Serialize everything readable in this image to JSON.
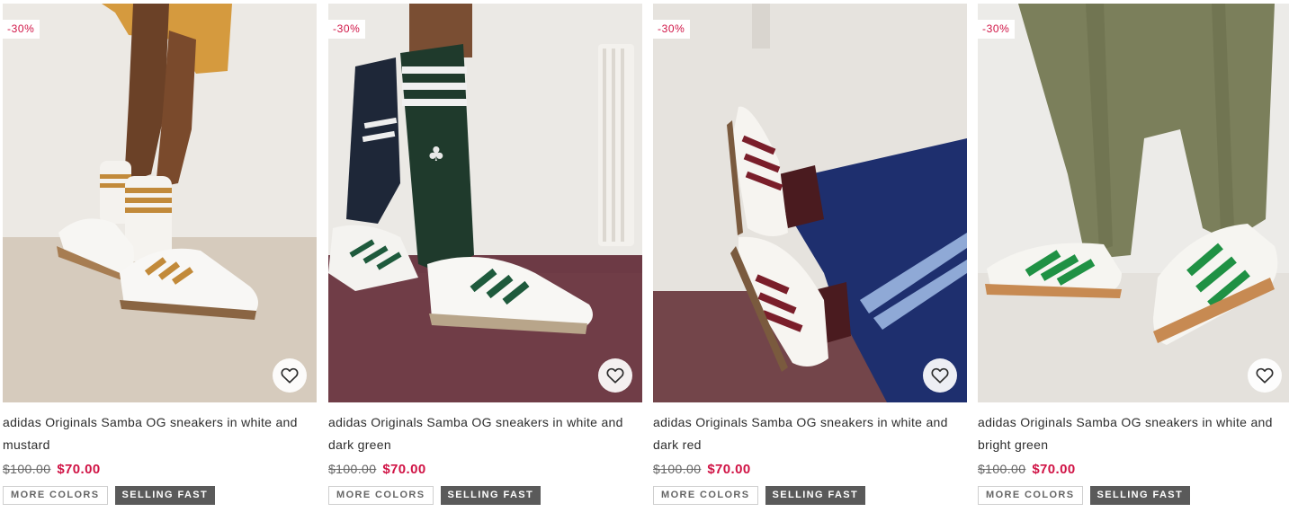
{
  "products": [
    {
      "badge": "-30%",
      "title": "adidas Originals Samba OG sneakers in white and mustard",
      "price_old": "$100.00",
      "price_new": "$70.00",
      "tag_more": "MORE COLORS",
      "tag_fast": "SELLING FAST",
      "image": "white-mustard-sneakers-photo"
    },
    {
      "badge": "-30%",
      "title": "adidas Originals Samba OG sneakers in white and dark green",
      "price_old": "$100.00",
      "price_new": "$70.00",
      "tag_more": "MORE COLORS",
      "tag_fast": "SELLING FAST",
      "image": "white-dark-green-sneakers-photo"
    },
    {
      "badge": "-30%",
      "title": "adidas Originals Samba OG sneakers in white and dark red",
      "price_old": "$100.00",
      "price_new": "$70.00",
      "tag_more": "MORE COLORS",
      "tag_fast": "SELLING FAST",
      "image": "white-dark-red-sneakers-photo"
    },
    {
      "badge": "-30%",
      "title": "adidas Originals Samba OG sneakers in white and bright green",
      "price_old": "$100.00",
      "price_new": "$70.00",
      "tag_more": "MORE COLORS",
      "tag_fast": "SELLING FAST",
      "image": "white-bright-green-sneakers-photo"
    }
  ],
  "icons": {
    "save": "heart-icon"
  },
  "colors": {
    "sale_red": "#d01345",
    "tag_gray": "#5a5a5a"
  }
}
